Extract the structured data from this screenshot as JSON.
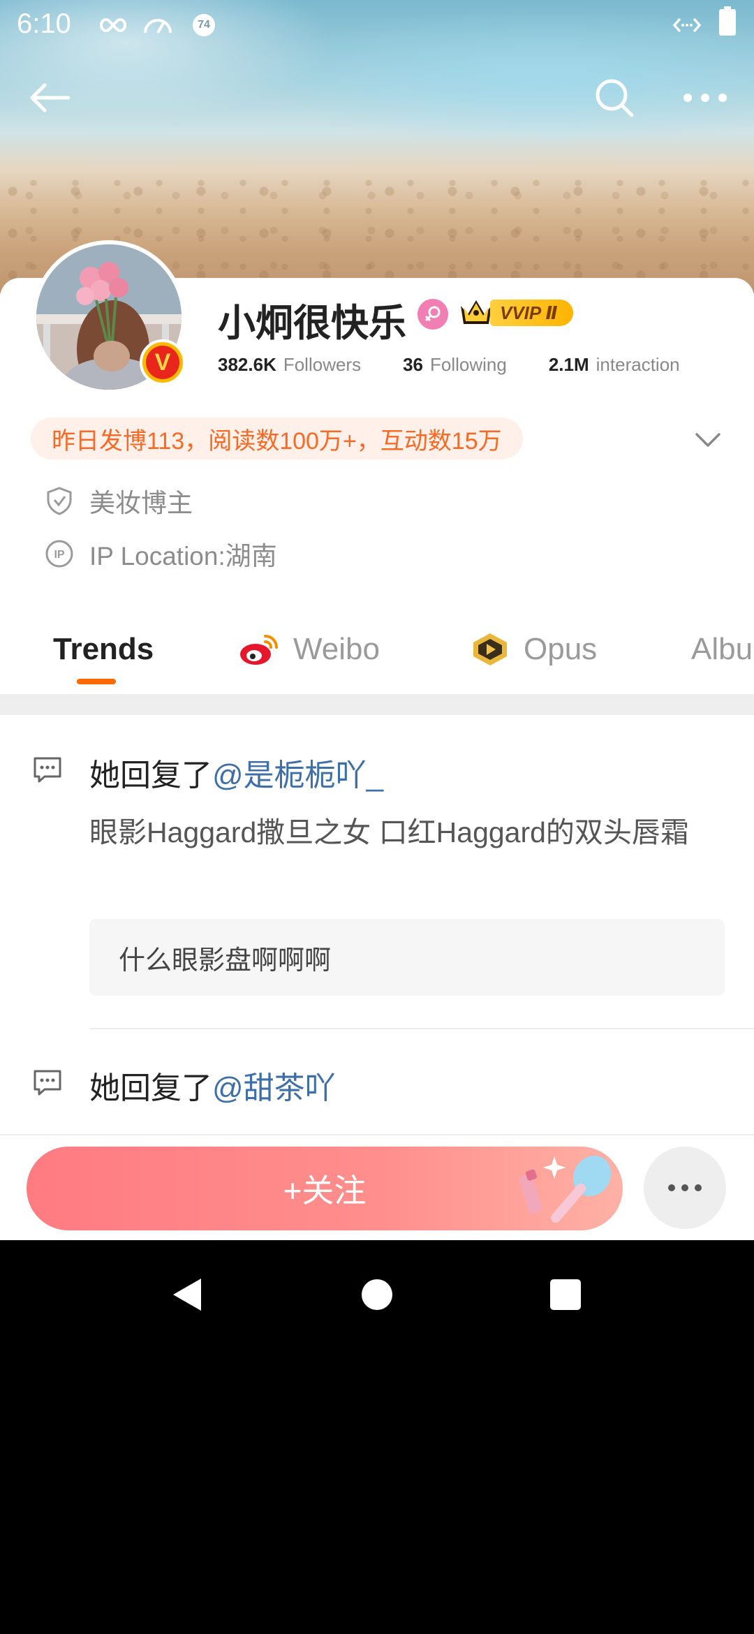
{
  "status_bar": {
    "time": "6:10",
    "notification_badge": "74"
  },
  "profile": {
    "name": "小炯很快乐",
    "vip_label": "VVIP Ⅱ",
    "stats": [
      {
        "value": "382.6K",
        "label": "Followers"
      },
      {
        "value": "36",
        "label": "Following"
      },
      {
        "value": "2.1M",
        "label": "interaction"
      }
    ],
    "activity_summary": "昨日发博113，阅读数100万+，互动数15万",
    "tags": [
      {
        "icon": "shield-check-icon",
        "text": "美妆博主"
      },
      {
        "icon": "ip-icon",
        "text": "IP Location:湖南"
      }
    ]
  },
  "tabs": [
    {
      "label": "Trends",
      "active": true
    },
    {
      "label": "Weibo",
      "icon": "weibo-logo-icon"
    },
    {
      "label": "Opus",
      "icon": "opus-icon"
    },
    {
      "label": "Albu"
    }
  ],
  "feed": [
    {
      "prefix": "她回复了",
      "mention": "@是栀栀吖_",
      "body": "眼影Haggard撒旦之女 口红Haggard的双头唇霜",
      "quote": "什么眼影盘啊啊啊"
    },
    {
      "prefix": "她回复了",
      "mention": "@甜茶吖"
    }
  ],
  "bottom_bar": {
    "follow_label": "+关注"
  },
  "colors": {
    "accent_orange": "#ff6a00",
    "mention_blue": "#3f6fa8",
    "follow_pink": "#ff7b82"
  }
}
